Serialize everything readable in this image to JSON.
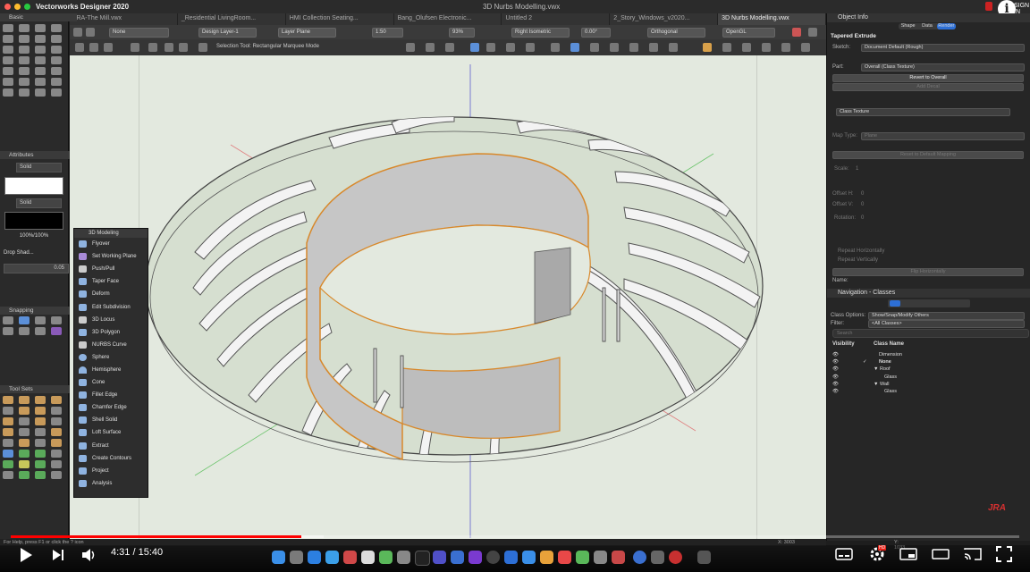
{
  "app": {
    "name": "Vectorworks Designer 2020",
    "window_title": "3D Nurbs Modelling.vwx"
  },
  "tabs": [
    {
      "label": "JRA-The Mill.vwx",
      "active": false
    },
    {
      "label": "_Residential LivingRoom...",
      "active": false
    },
    {
      "label": "HMI Collection Seating...",
      "active": false
    },
    {
      "label": "Bang_Olufsen Electronic...",
      "active": false
    },
    {
      "label": "Untitled 2",
      "active": false
    },
    {
      "label": "2_Story_Windows_v2020...",
      "active": false
    },
    {
      "label": "3D Nurbs Modelling.vwx",
      "active": true
    }
  ],
  "toolbar": {
    "class_select": "None",
    "layer_select": "Design Layer-1",
    "plane_select": "Layer Plane",
    "scale": "1:50",
    "zoom": "93%",
    "view_select": "Right Isometric",
    "angle": "0.00°",
    "projection": "Orthogonal",
    "render_mode": "OpenGL",
    "mode_hint": "Selection Tool: Rectangular Marquee Mode"
  },
  "left": {
    "basic_title": "Basic",
    "attributes_title": "Attributes",
    "fill_style": "Solid",
    "pen_style": "Solid",
    "opacity": "100%/100%",
    "drop_shadow": "Drop Shad...",
    "line_weight": "0.05",
    "snapping_title": "Snapping",
    "tool_sets_title": "Tool Sets"
  },
  "palette_3d": {
    "title": "3D Modeling",
    "items": [
      "Flyover",
      "Set Working Plane",
      "Push/Pull",
      "Taper Face",
      "Deform",
      "Edit Subdivision",
      "3D Locus",
      "3D Polygon",
      "NURBS Curve",
      "Sphere",
      "Hemisphere",
      "Cone",
      "Fillet Edge",
      "Chamfer Edge",
      "Shell Solid",
      "Loft Surface",
      "Extract",
      "Create Contours",
      "Project",
      "Analysis"
    ]
  },
  "object_info": {
    "title": "Object Info",
    "tabs": [
      "Shape",
      "Data",
      "Render"
    ],
    "active_tab": "Render",
    "object_type": "Tapered Extrude",
    "sketch_label": "Sketch:",
    "sketch_value": "Document Default (Rough)",
    "part_label": "Part:",
    "part_value": "Overall (Class Texture)",
    "revert_button": "Revert to Overall",
    "add_decal_button": "Add Decal",
    "texture_value": "Class Texture",
    "map_type_label": "Map Type:",
    "map_type_value": "Plane",
    "reset_mapping_button": "Reset to Default Mapping",
    "scale_label": "Scale:",
    "scale_value": "1",
    "offset_h_label": "Offset H:",
    "offset_h_value": "0",
    "offset_v_label": "Offset V:",
    "offset_v_value": "0",
    "rotation_label": "Rotation:",
    "rotation_value": "0",
    "repeat_h": "Repeat Horizontally",
    "repeat_v": "Repeat Vertically",
    "flip_h_button": "Flip Horizontally",
    "name_label": "Name:"
  },
  "navigation": {
    "title": "Navigation - Classes",
    "class_options_label": "Class Options:",
    "class_options_value": "Show/Snap/Modify Others",
    "filter_label": "Filter:",
    "filter_value": "<All Classes>",
    "search_placeholder": "Search",
    "col_visibility": "Visibility",
    "col_class_name": "Class Name",
    "classes": [
      {
        "name": "Dimension",
        "check": ""
      },
      {
        "name": "None",
        "check": "✓"
      },
      {
        "name": "▼ Roof",
        "check": ""
      },
      {
        "name": "Glass",
        "check": ""
      },
      {
        "name": "▼ Wall",
        "check": ""
      },
      {
        "name": "Glass",
        "check": ""
      }
    ]
  },
  "status": {
    "help_text": "For Help, press F1 or click the ? icon",
    "x_readout": "X: 3003",
    "y_readout": "Y: 1033"
  },
  "video": {
    "current_time": "4:31",
    "duration": "15:40",
    "time_display": "4:31 / 15:40",
    "progress": 0.288,
    "buffered": 0.31,
    "hd_badge": "HD"
  },
  "brand": {
    "sign_in": "SIGN IN",
    "watermark": "JRA"
  },
  "colors": {
    "accent_blue": "#2d6fd6",
    "ring_fill": "#d8e2d2",
    "highlight_orange": "#d8882a",
    "progress_red": "#ff0000"
  }
}
